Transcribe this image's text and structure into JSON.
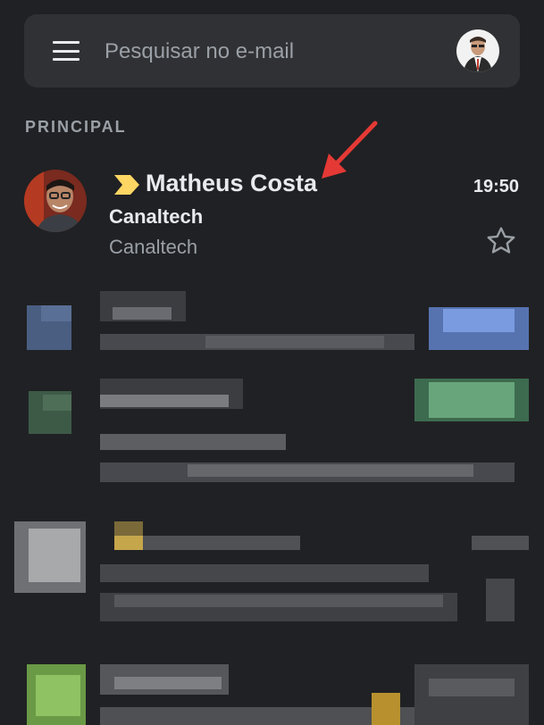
{
  "search": {
    "placeholder": "Pesquisar no e-mail"
  },
  "icons": {
    "menu": "menu-icon",
    "importance": "importance-marker-icon",
    "star": "star-icon"
  },
  "colors": {
    "background": "#202124",
    "search_bar": "#303134",
    "importance_marker": "#fdd663",
    "annotation_arrow": "#e53935"
  },
  "section": {
    "label": "PRINCIPAL"
  },
  "emails": [
    {
      "sender": "Matheus Costa",
      "time": "19:50",
      "subject": "Canaltech",
      "snippet": "Canaltech",
      "starred": false,
      "important": true
    }
  ]
}
